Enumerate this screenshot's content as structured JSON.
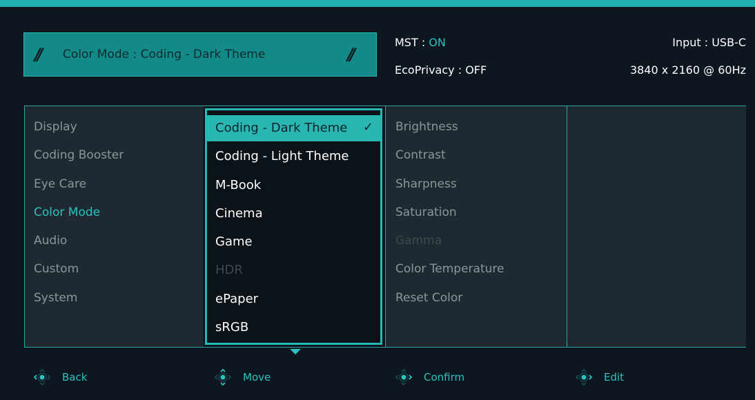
{
  "header": {
    "color_mode_label": "Color Mode : Coding - Dark Theme",
    "mst_label": "MST : ",
    "mst_value": "ON",
    "ecoprivacy": "EcoPrivacy : OFF",
    "input": "Input : USB-C",
    "resolution": "3840 x 2160 @ 60Hz"
  },
  "main_menu": [
    "Display",
    "Coding Booster",
    "Eye Care",
    "Color Mode",
    "Audio",
    "Custom",
    "System"
  ],
  "color_modes": [
    "Coding - Dark Theme",
    "Coding - Light Theme",
    "M-Book",
    "Cinema",
    "Game",
    "HDR",
    "ePaper",
    "sRGB"
  ],
  "settings": [
    "Brightness",
    "Contrast",
    "Sharpness",
    "Saturation",
    "Gamma",
    "Color Temperature",
    "Reset Color"
  ],
  "footer": {
    "back": "Back",
    "move": "Move",
    "confirm": "Confirm",
    "edit": "Edit"
  },
  "icons": {
    "checkmark": "check-icon",
    "joystick": "joystick-icon",
    "more_below": "down-arrow-icon"
  },
  "colors": {
    "accent": "#2ac4c0",
    "banner": "#138a88",
    "background": "#0e1620",
    "panel": "#1e2931"
  }
}
